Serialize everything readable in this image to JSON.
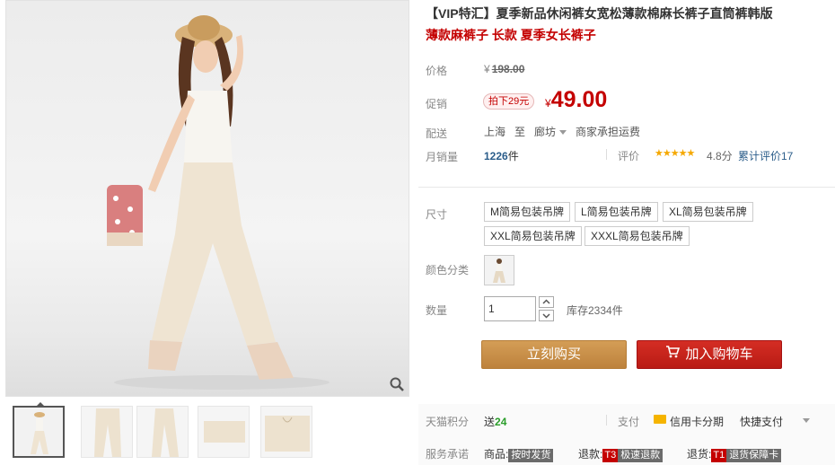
{
  "product": {
    "title": "【VIP特汇】夏季新品休闲裤女宽松薄款棉麻长裤子直筒裤韩版",
    "subtitle": "薄款麻裤子 长款 夏季女长裤子"
  },
  "price": {
    "label": "价格",
    "currency": "¥",
    "original": "198.00",
    "promo_label": "促销",
    "promo_badge": "拍下29元",
    "promo_price": "49.00"
  },
  "shipping": {
    "label": "配送",
    "from": "上海",
    "to_word": "至",
    "destination": "廊坊",
    "fee": "商家承担运费"
  },
  "sales": {
    "label": "月销量",
    "count": "1226",
    "unit": "件",
    "rating_label": "评价",
    "stars": "★★★★★",
    "score": "4.8分",
    "total_reviews": "累计评价17"
  },
  "size": {
    "label": "尺寸",
    "options": [
      "M简易包装吊牌",
      "L简易包装吊牌",
      "XL简易包装吊牌",
      "XXL简易包装吊牌",
      "XXXL简易包装吊牌"
    ]
  },
  "color": {
    "label": "颜色分类"
  },
  "quantity": {
    "label": "数量",
    "value": "1",
    "stock": "库存2334件"
  },
  "actions": {
    "buy_now": "立刻购买",
    "add_to_cart": "加入购物车"
  },
  "bottom": {
    "points_label": "天猫积分",
    "points_prefix": "送",
    "points_value": "24",
    "pay_label": "支付",
    "credit_card": "信用卡分期",
    "quick_pay": "快捷支付",
    "service_label": "服务承诺",
    "goods_prefix": "商品:",
    "goods_tag": "按时发货",
    "refund_prefix": "退款:",
    "refund_code": "T3",
    "refund_tag": "极速退款",
    "return_prefix": "退货:",
    "return_code": "T1",
    "return_tag": "退货保障卡"
  },
  "colors": {
    "accent_red": "#c40000",
    "buy_button": "#c8904a",
    "cart_button": "#c41a14",
    "star": "#f5a800"
  }
}
